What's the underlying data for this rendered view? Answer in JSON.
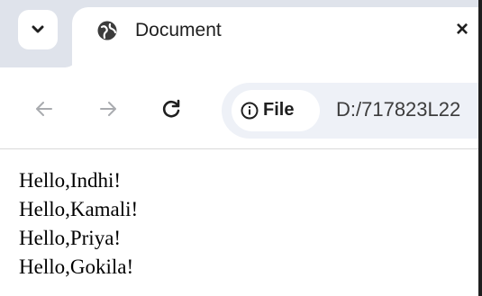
{
  "browser": {
    "tab": {
      "title": "Document",
      "favicon": "globe-icon",
      "close": "×"
    },
    "tab_search_icon": "chevron-down-icon",
    "nav": {
      "back_icon": "arrow-left-icon",
      "forward_icon": "arrow-right-icon",
      "reload_icon": "reload-icon"
    },
    "address_bar": {
      "chip_icon": "info-icon",
      "chip_label": "File",
      "url": "D:/717823L22"
    }
  },
  "page": {
    "lines": [
      "Hello,Indhi!",
      "Hello,Kamali!",
      "Hello,Priya!",
      "Hello,Gokila!"
    ]
  },
  "colors": {
    "tabstrip": "#dfe3eb",
    "omnibox": "#eef1f7",
    "text": "#1f1f1f"
  }
}
